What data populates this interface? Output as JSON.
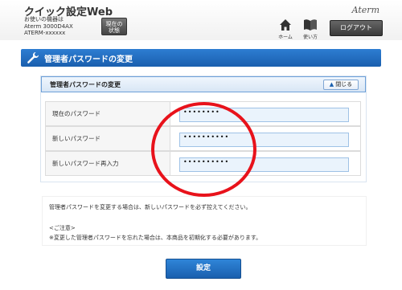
{
  "header": {
    "app_title": "クイック設定Web",
    "device_label": "お使いの機器は",
    "device_model": "Aterm 3000D4AX",
    "device_id": "ATERM-xxxxxx",
    "status_button": "現在の\n状態",
    "brand": "Aterm",
    "home_label": "ホーム",
    "manual_label": "使い方",
    "logout_label": "ログアウト"
  },
  "banner": {
    "title": "管理者パスワードの変更",
    "icon": "wrench-icon"
  },
  "panel": {
    "title": "管理者パスワードの変更",
    "close_label": "閉じる",
    "rows": [
      {
        "label": "現在のパスワード",
        "value": "••••••••"
      },
      {
        "label": "新しいパスワード",
        "value": "••••••••••"
      },
      {
        "label": "新しいパスワード再入力",
        "value": "••••••••••"
      }
    ]
  },
  "note": {
    "line1": "管理者パスワードを変更する場合は、新しいパスワードを必ず控えてください。",
    "line2": "<ご注意>",
    "line3": "※変更した管理者パスワードを忘れた場合は、本商品を初期化する必要があります。"
  },
  "submit_label": "設定",
  "colors": {
    "accent": "#1a5fae",
    "highlight": "#e8121b",
    "input_bg": "#eaf3fc"
  }
}
